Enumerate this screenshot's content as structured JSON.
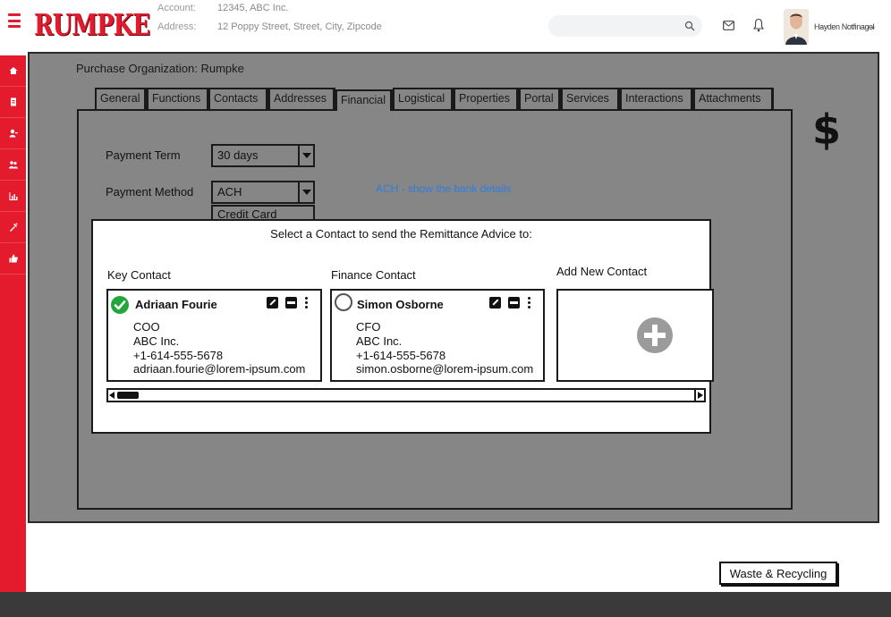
{
  "header": {
    "logo_text": "RUMPKE",
    "account_label": "Account:",
    "account_value": "12345, ABC Inc.",
    "address_label": "Address:",
    "address_value": "12 Poppy Street, Street, City, Zipcode",
    "search_placeholder": "",
    "user_name": "Hayden Notfinagel",
    "user_chevron": "⌄"
  },
  "sidebar": {
    "items": [
      "home-icon",
      "document-icon",
      "user-icon",
      "users-icon",
      "chart-icon",
      "tools-icon",
      "thumbs-up-icon"
    ]
  },
  "page": {
    "org_title": "Purchase Organization: Rumpke",
    "tabs": [
      "General",
      "Functions",
      "Contacts",
      "Addresses",
      "Financial",
      "Logistical",
      "Properties",
      "Portal",
      "Services",
      "Interactions",
      "Attachments"
    ],
    "active_tab": "Financial",
    "currency_symbol": "$"
  },
  "form": {
    "payment_term_label": "Payment Term",
    "payment_term_value": "30 days",
    "payment_method_label": "Payment Method",
    "payment_method_value": "ACH",
    "payment_method_option": "Credit Card",
    "ach_note": "ACH - show the bank details"
  },
  "modal": {
    "title": "Select a Contact to send the Remittance Advice to:",
    "key_contact_label": "Key Contact",
    "finance_contact_label": "Finance Contact",
    "add_contact_label": "Add New Contact",
    "contacts": [
      {
        "name": "Adriaan Fourie",
        "title": "COO",
        "company": "ABC Inc.",
        "phone": "+1-614-555-5678",
        "email": "adriaan.fourie@lorem-ipsum.com",
        "selected": true
      },
      {
        "name": "Simon Osborne",
        "title": "CFO",
        "company": "ABC Inc.",
        "phone": "+1-614-555-5678",
        "email": "simon.osborne@lorem-ipsum.com",
        "selected": false
      }
    ]
  },
  "footer": {
    "waste_button": "Waste & Recycling"
  },
  "colors": {
    "brand_red": "#e31b2d",
    "canvas_gray": "#868686",
    "check_green": "#21a639",
    "link_blue": "#2f7de1",
    "footer_dark": "#3a3a3a"
  }
}
